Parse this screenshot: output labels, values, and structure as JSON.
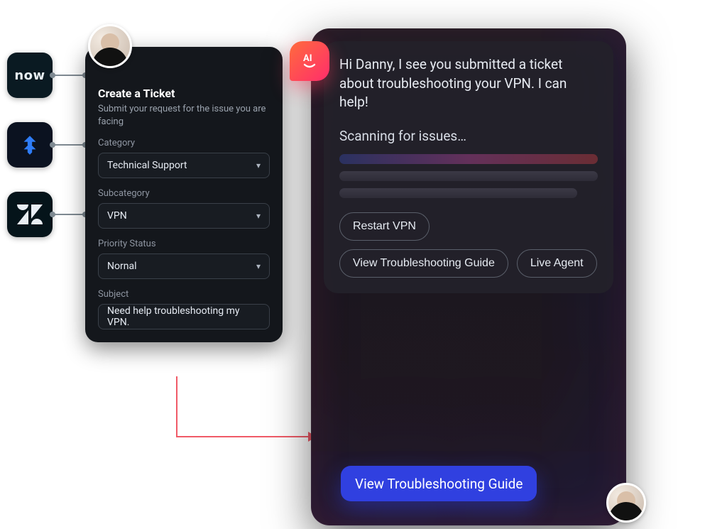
{
  "integrations": [
    {
      "id": "servicenow",
      "label": "now"
    },
    {
      "id": "jira",
      "label": "jira"
    },
    {
      "id": "zendesk",
      "label": "zendesk"
    }
  ],
  "ticket": {
    "title": "Create a Ticket",
    "subtitle": "Submit your request for the issue you are facing",
    "fields": {
      "category": {
        "label": "Category",
        "value": "Technical Support"
      },
      "subcategory": {
        "label": "Subcategory",
        "value": "VPN"
      },
      "priority": {
        "label": "Priority Status",
        "value": "Nornal"
      },
      "subject": {
        "label": "Subject",
        "value": "Need help troubleshooting my VPN."
      }
    }
  },
  "ai": {
    "badge": "AI",
    "greeting": "Hi Danny, I see you submitted a ticket about troubleshooting your VPN. I can help!",
    "scanning": "Scanning for issues…",
    "actions": [
      "Restart VPN",
      "View Troubleshooting Guide",
      "Live Agent"
    ]
  },
  "reply": {
    "label": "View Troubleshooting Guide"
  }
}
